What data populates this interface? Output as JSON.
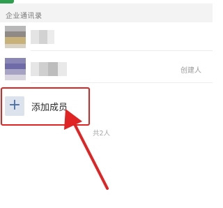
{
  "section": {
    "title": "企业通讯录"
  },
  "members": [
    {
      "role": ""
    },
    {
      "role": "创建人"
    }
  ],
  "add_member": {
    "label": "添加成员",
    "icon": "plus-icon"
  },
  "member_count": "共2人",
  "colors": {
    "accent_green": "#2f9e4f",
    "highlight_red": "#e02424",
    "add_icon_bg": "#dde3ec",
    "add_icon_fg": "#4a6fa5"
  }
}
